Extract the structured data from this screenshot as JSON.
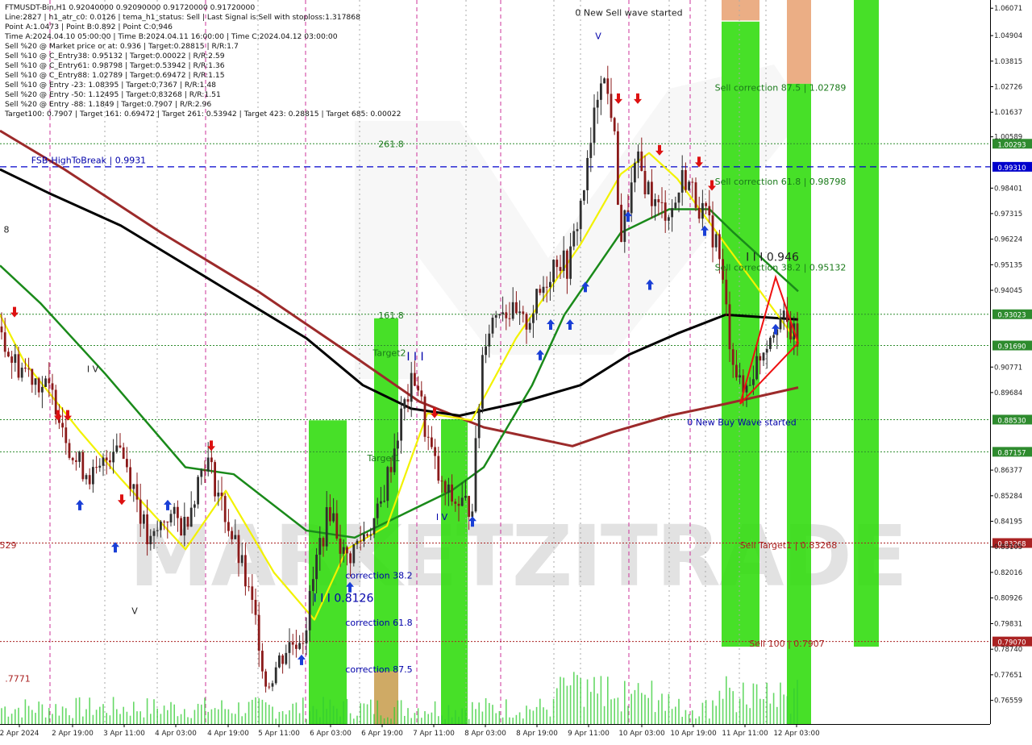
{
  "header": {
    "lines": [
      "FTMUSDT-Bin,H1  0.92040000 0.92090000 0.91720000 0.91720000",
      "Line:2827  |  h1_atr_c0: 0.0126  |  tema_h1_status: Sell  |  Last Signal is:Sell with stoploss:1.317868",
      "Point A:1.0473  |  Point B:0.892  |  Point C:0.946",
      "Time A:2024.04.10 05:00:00  |  Time B:2024.04.11 16:00:00  |  Time C:2024.04.12 03:00:00",
      "Sell %20 @ Market price or at: 0.936  |  Target:0.28815  |  R/R:1.7",
      "Sell %10 @ C_Entry38: 0.95132  |  Target:0.00022  |  R/R:2.59",
      "Sell %10 @ C_Entry61: 0.98798  |  Target:0.53942  |  R/R:1.36",
      "Sell %10 @ C_Entry88: 1.02789  |  Target:0.69472  |  R/R:1.15",
      "Sell %10 @ Entry -23: 1.08395  |  Target:0.7367  |  R/R:1.48",
      "Sell %20 @ Entry -50: 1.12495  |  Target:0.83268  |  R/R:1.51",
      "Sell %20 @ Entry -88: 1.1849  |  Target:0.7907  |  R/R:2.96",
      "Target100: 0.7907  |  Target 161: 0.69472  |  Target 261: 0.53942  |  Target 423: 0.28815  |  Target 685: 0.00022"
    ]
  },
  "colors": {
    "bullish": "#2f2f2f",
    "bearish": "#8b1a1a",
    "ma_red": "#9c2a2a",
    "ma_black": "#000000",
    "ma_green": "#1a8a1a",
    "tema_yellow": "#f2f200",
    "zone_green": "#33dd11",
    "zone_orange": "#e8a070",
    "arrow_up": "#1a3fd6",
    "arrow_down": "#dd1111",
    "level_green": "#2e8b2e",
    "level_blue": "#0000cc",
    "level_red": "#aa2222",
    "watermark": "#bfbfbf"
  },
  "watermark": {
    "text": "MARKETZITRADE"
  },
  "chart_data": {
    "type": "candlestick",
    "symbol": "FTMUSDT-Bin",
    "timeframe": "H1",
    "ylim": [
      0.7555,
      1.0625
    ],
    "y_ticks": [
      "1.06071",
      "1.04904",
      "1.03815",
      "1.02726",
      "1.01637",
      "1.00589",
      "0.98401",
      "0.97315",
      "0.96224",
      "0.95135",
      "0.94045",
      "0.90771",
      "0.89684",
      "0.86377",
      "0.85284",
      "0.84195",
      "0.83105",
      "0.82016",
      "0.80926",
      "0.79831",
      "0.78740",
      "0.77651",
      "0.76559"
    ],
    "x_ticks": [
      "2 Apr 2024",
      "2 Apr 19:00",
      "3 Apr 11:00",
      "4 Apr 03:00",
      "4 Apr 19:00",
      "5 Apr 11:00",
      "6 Apr 03:00",
      "6 Apr 19:00",
      "7 Apr 11:00",
      "8 Apr 03:00",
      "8 Apr 19:00",
      "9 Apr 11:00",
      "10 Apr 03:00",
      "10 Apr 19:00",
      "11 Apr 11:00",
      "12 Apr 03:00"
    ],
    "price_path": [
      [
        0.925,
        0
      ],
      [
        0.91,
        16
      ],
      [
        0.905,
        40
      ],
      [
        0.893,
        70
      ],
      [
        0.868,
        92
      ],
      [
        0.86,
        120
      ],
      [
        0.878,
        145
      ],
      [
        0.855,
        168
      ],
      [
        0.83,
        185
      ],
      [
        0.845,
        206
      ],
      [
        0.84,
        228
      ],
      [
        0.87,
        255
      ],
      [
        0.855,
        270
      ],
      [
        0.822,
        300
      ],
      [
        0.795,
        320
      ],
      [
        0.772,
        330
      ],
      [
        0.788,
        355
      ],
      [
        0.795,
        378
      ],
      [
        0.83,
        395
      ],
      [
        0.848,
        410
      ],
      [
        0.825,
        428
      ],
      [
        0.838,
        455
      ],
      [
        0.845,
        470
      ],
      [
        0.89,
        500
      ],
      [
        0.905,
        516
      ],
      [
        0.88,
        528
      ],
      [
        0.855,
        548
      ],
      [
        0.85,
        565
      ],
      [
        0.848,
        585
      ],
      [
        0.92,
        600
      ],
      [
        0.935,
        620
      ],
      [
        0.925,
        650
      ],
      [
        0.935,
        665
      ],
      [
        0.955,
        690
      ],
      [
        0.95,
        705
      ],
      [
        0.995,
        730
      ],
      [
        1.035,
        745
      ],
      [
        1.015,
        760
      ],
      [
        0.962,
        770
      ],
      [
        0.995,
        790
      ],
      [
        0.975,
        815
      ],
      [
        0.975,
        835
      ],
      [
        0.99,
        848
      ],
      [
        0.975,
        870
      ],
      [
        0.96,
        890
      ],
      [
        0.92,
        905
      ],
      [
        0.895,
        920
      ],
      [
        0.915,
        945
      ],
      [
        0.93,
        965
      ],
      [
        0.918,
        990
      ]
    ],
    "levels": [
      {
        "label": "1.00293",
        "price": 1.00293,
        "color": "#2e8b2e",
        "style": "dotted"
      },
      {
        "label": "0.99310",
        "price": 0.9931,
        "color": "#0000cc",
        "style": "dashed"
      },
      {
        "label": "0.93023",
        "price": 0.93023,
        "color": "#2e8b2e",
        "style": "dotted"
      },
      {
        "label": "0.91690",
        "price": 0.9169,
        "color": "#2e8b2e",
        "style": "dotted"
      },
      {
        "label": "0.88530",
        "price": 0.8853,
        "color": "#2e8b2e",
        "style": "dotted"
      },
      {
        "label": "0.87157",
        "price": 0.87157,
        "color": "#2e8b2e",
        "style": "dotted"
      },
      {
        "label": "0.83268",
        "price": 0.83268,
        "color": "#aa2222",
        "style": "dotted"
      },
      {
        "label": "0.79070",
        "price": 0.7907,
        "color": "#aa2222",
        "style": "dotted"
      }
    ],
    "annotations": [
      {
        "text": "0 New Sell wave started",
        "price": 1.0575,
        "xi": 780,
        "color": "#222222"
      },
      {
        "text": "Sell correction 87.5 | 1.02789",
        "price": 1.0255,
        "xi": 968,
        "color": "#1a7a1a"
      },
      {
        "text": "Sell correction 61.8 | 0.98798",
        "price": 0.9855,
        "xi": 968,
        "color": "#1a7a1a"
      },
      {
        "text": "Sell correction 38.2 | 0.95132",
        "price": 0.9488,
        "xi": 968,
        "color": "#1a7a1a"
      },
      {
        "text": "I I I 0.946",
        "price": 0.953,
        "xi": 958,
        "color": "#222222"
      },
      {
        "text": "261.8",
        "price": 1.0015,
        "xi": 485,
        "color": "#1a7a1a"
      },
      {
        "text": "161.8",
        "price": 0.9285,
        "xi": 485,
        "color": "#1a7a1a"
      },
      {
        "text": "Target2",
        "price": 0.9125,
        "xi": 483,
        "color": "#1a7a1a"
      },
      {
        "text": "Target1",
        "price": 0.8675,
        "xi": 476,
        "color": "#1a7a1a"
      },
      {
        "text": "FSB-HighToBreak  |  0.9931",
        "price": 0.9946,
        "xi": 110,
        "color": "#0000aa"
      },
      {
        "text": "0 New Buy Wave started",
        "price": 0.8828,
        "xi": 920,
        "color": "#0000aa"
      },
      {
        "text": "Sell Target1 | 0.83268",
        "price": 0.8305,
        "xi": 978,
        "color": "#aa2222"
      },
      {
        "text": "Sell 100 | 0.7907",
        "price": 0.7885,
        "xi": 976,
        "color": "#aa2222"
      },
      {
        "text": "correction 38.2",
        "price": 0.8175,
        "xi": 470,
        "color": "#0000aa"
      },
      {
        "text": "correction 61.8",
        "price": 0.7975,
        "xi": 470,
        "color": "#0000aa"
      },
      {
        "text": "correction 87.5",
        "price": 0.7775,
        "xi": 470,
        "color": "#0000aa"
      },
      {
        "text": "I I I 0.8126",
        "price": 0.8075,
        "xi": 426,
        "color": "#0000aa"
      },
      {
        "text": ".7771",
        "price": 0.7735,
        "xi": 22,
        "color": "#aa2222"
      },
      {
        "text": "529",
        "price": 0.8305,
        "xi": 10,
        "color": "#aa2222"
      },
      {
        "text": "I I I",
        "price": 0.9105,
        "xi": 515,
        "color": "#0000aa"
      },
      {
        "text": "I V",
        "price": 0.8425,
        "xi": 548,
        "color": "#0000aa"
      },
      {
        "text": "V",
        "price": 1.0475,
        "xi": 742,
        "color": "#0000aa"
      },
      {
        "text": "I V",
        "price": 0.9055,
        "xi": 115,
        "color": "#222222"
      },
      {
        "text": "V",
        "price": 0.8025,
        "xi": 167,
        "color": "#222222"
      },
      {
        "text": "8",
        "price": 0.965,
        "xi": 8,
        "color": "#222222"
      }
    ],
    "arrows_up": [
      [
        0.848,
        99
      ],
      [
        0.83,
        143
      ],
      [
        0.848,
        208
      ],
      [
        0.782,
        374
      ],
      [
        0.813,
        434
      ],
      [
        0.841,
        586
      ],
      [
        0.912,
        670
      ],
      [
        0.925,
        683
      ],
      [
        0.925,
        707
      ],
      [
        0.941,
        726
      ],
      [
        0.942,
        806
      ],
      [
        0.971,
        779
      ],
      [
        0.965,
        874
      ],
      [
        0.923,
        962
      ]
    ],
    "arrows_down": [
      [
        0.932,
        18
      ],
      [
        0.888,
        72
      ],
      [
        0.888,
        84
      ],
      [
        0.852,
        151
      ],
      [
        0.875,
        262
      ],
      [
        0.889,
        539
      ],
      [
        1.023,
        767
      ],
      [
        1.023,
        791
      ],
      [
        1.001,
        818
      ],
      [
        0.996,
        867
      ],
      [
        0.986,
        883
      ]
    ]
  }
}
